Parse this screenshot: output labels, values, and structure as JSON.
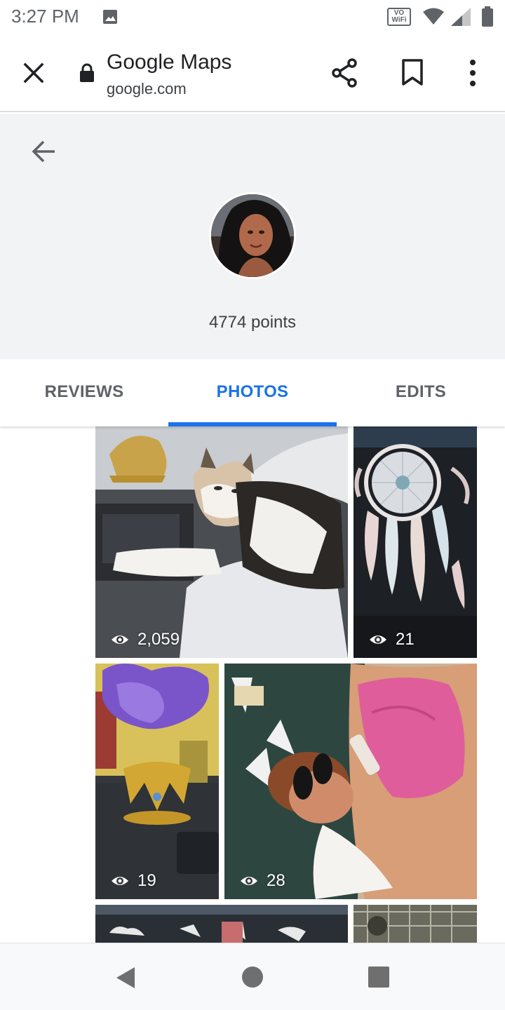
{
  "status_bar": {
    "time": "3:27 PM",
    "vowifi_line1": "VO",
    "vowifi_line2": "WiFi",
    "icons": [
      "image-icon",
      "wifi-icon",
      "signal-icon",
      "battery-icon"
    ]
  },
  "toolbar": {
    "title": "Google Maps",
    "url": "google.com",
    "icons": [
      "close-icon",
      "lock-icon",
      "share-icon",
      "bookmark-icon",
      "more-vert-icon"
    ]
  },
  "profile": {
    "points": "4774 points"
  },
  "tabs": [
    {
      "label": "REVIEWS",
      "active": false
    },
    {
      "label": "PHOTOS",
      "active": true
    },
    {
      "label": "EDITS",
      "active": false
    }
  ],
  "photos": [
    {
      "views": "2,059",
      "subject": "cat"
    },
    {
      "views": "21",
      "subject": "dreamcatcher"
    },
    {
      "views": "19",
      "subject": "crown"
    },
    {
      "views": "28",
      "subject": "person"
    }
  ],
  "colors": {
    "accent": "#1a73e8",
    "header_bg": "#f1f3f4",
    "tab_inactive": "#5f6368"
  }
}
